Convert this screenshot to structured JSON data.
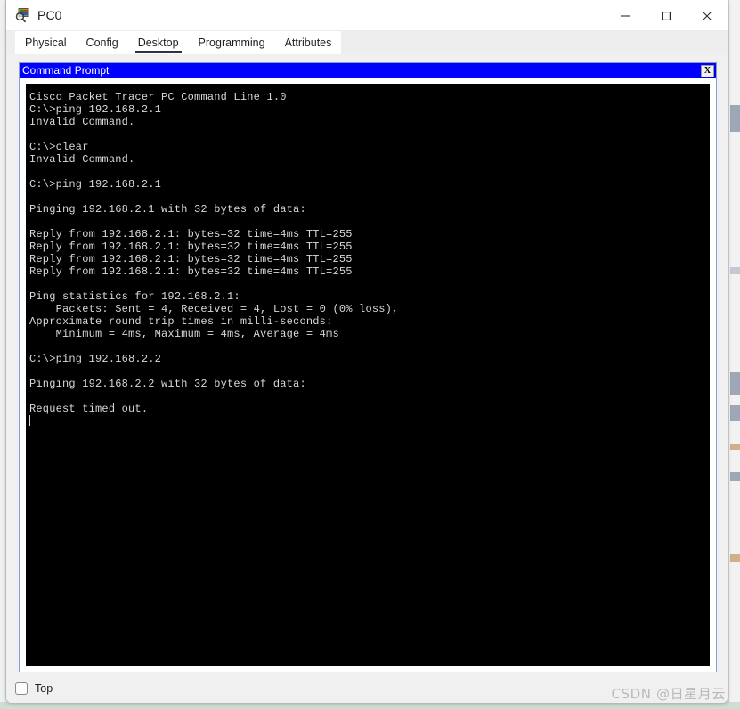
{
  "window": {
    "title": "PC0",
    "icon": "packet-tracer-icon",
    "controls": {
      "minimize": "—",
      "maximize": "□",
      "close": "✕"
    }
  },
  "tabs": [
    {
      "label": "Physical",
      "active": false
    },
    {
      "label": "Config",
      "active": false
    },
    {
      "label": "Desktop",
      "active": true
    },
    {
      "label": "Programming",
      "active": false
    },
    {
      "label": "Attributes",
      "active": false
    }
  ],
  "command_prompt": {
    "title": "Command Prompt",
    "close_label": "X",
    "title_bg": "#0000ff",
    "terminal_bg": "#000000",
    "terminal_fg": "#d8d8d8",
    "lines": [
      "Cisco Packet Tracer PC Command Line 1.0",
      "C:\\>ping 192.168.2.1",
      "Invalid Command.",
      "",
      "C:\\>clear",
      "Invalid Command.",
      "",
      "C:\\>ping 192.168.2.1",
      "",
      "Pinging 192.168.2.1 with 32 bytes of data:",
      "",
      "Reply from 192.168.2.1: bytes=32 time=4ms TTL=255",
      "Reply from 192.168.2.1: bytes=32 time=4ms TTL=255",
      "Reply from 192.168.2.1: bytes=32 time=4ms TTL=255",
      "Reply from 192.168.2.1: bytes=32 time=4ms TTL=255",
      "",
      "Ping statistics for 192.168.2.1:",
      "    Packets: Sent = 4, Received = 4, Lost = 0 (0% loss),",
      "Approximate round trip times in milli-seconds:",
      "    Minimum = 4ms, Maximum = 4ms, Average = 4ms",
      "",
      "C:\\>ping 192.168.2.2",
      "",
      "Pinging 192.168.2.2 with 32 bytes of data:",
      "",
      "Request timed out."
    ]
  },
  "bottom": {
    "top_checkbox_label": "Top",
    "top_checkbox_checked": false
  },
  "watermark": "CSDN @日星月云"
}
